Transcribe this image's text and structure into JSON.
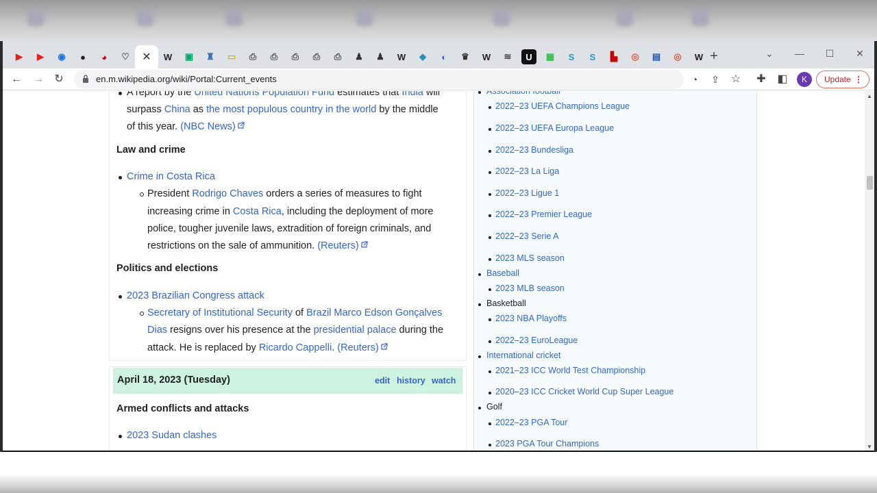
{
  "browser": {
    "url": "en.m.wikipedia.org/wiki/Portal:Current_events",
    "update_label": "Update",
    "avatar_letter": "K",
    "tabs": [
      {
        "icon": "youtube-icon",
        "glyph": "▶",
        "color": "#e62117"
      },
      {
        "icon": "youtube-icon",
        "glyph": "▶",
        "color": "#e62117"
      },
      {
        "icon": "globe-icon",
        "glyph": "◉",
        "color": "#1a73e8"
      },
      {
        "icon": "circle-logo-icon",
        "glyph": "●",
        "color": "#222"
      },
      {
        "icon": "ball-icon",
        "glyph": "◕",
        "color": "#c00"
      },
      {
        "icon": "shield-icon",
        "glyph": "♡",
        "color": "#555"
      },
      {
        "icon": "close-icon",
        "glyph": "✕",
        "color": "#333"
      },
      {
        "icon": "wikipedia-icon",
        "glyph": "W",
        "color": "#222"
      },
      {
        "icon": "square-logo-icon",
        "glyph": "▣",
        "color": "#0a6"
      },
      {
        "icon": "crest-icon",
        "glyph": "♜",
        "color": "#3a6fb0"
      },
      {
        "icon": "frame-icon",
        "glyph": "▭",
        "color": "#e0b000"
      },
      {
        "icon": "printer-icon",
        "glyph": "⎙",
        "color": "#555"
      },
      {
        "icon": "printer-icon",
        "glyph": "⎙",
        "color": "#555"
      },
      {
        "icon": "printer-icon",
        "glyph": "⎙",
        "color": "#555"
      },
      {
        "icon": "printer-icon",
        "glyph": "⎙",
        "color": "#555"
      },
      {
        "icon": "printer-icon",
        "glyph": "⎙",
        "color": "#555"
      },
      {
        "icon": "figure-icon",
        "glyph": "♟",
        "color": "#333"
      },
      {
        "icon": "figure-icon",
        "glyph": "♟",
        "color": "#333"
      },
      {
        "icon": "wikipedia-icon",
        "glyph": "W",
        "color": "#222"
      },
      {
        "icon": "drop-icon",
        "glyph": "◆",
        "color": "#2a8fbd"
      },
      {
        "icon": "globe-icon",
        "glyph": "◐",
        "color": "#2b5fd9"
      },
      {
        "icon": "crown-icon",
        "glyph": "♛",
        "color": "#333"
      },
      {
        "icon": "wikipedia-icon",
        "glyph": "W",
        "color": "#222"
      },
      {
        "icon": "strikes-icon",
        "glyph": "≋",
        "color": "#444"
      },
      {
        "icon": "u-logo-icon",
        "glyph": "U",
        "color": "#fff"
      },
      {
        "icon": "grid-icon",
        "glyph": "▦",
        "color": "#3cba54"
      },
      {
        "icon": "s-logo-icon",
        "glyph": "S",
        "color": "#1a9ad6"
      },
      {
        "icon": "s-logo-icon",
        "glyph": "S",
        "color": "#1a9ad6"
      },
      {
        "icon": "flag-icon",
        "glyph": "▙",
        "color": "#c00"
      },
      {
        "icon": "duck-icon",
        "glyph": "◎",
        "color": "#de5833"
      },
      {
        "icon": "screen-icon",
        "glyph": "▤",
        "color": "#2c5aa0"
      },
      {
        "icon": "duck-icon",
        "glyph": "◎",
        "color": "#de5833"
      },
      {
        "icon": "wikipedia-icon",
        "glyph": "W",
        "color": "#222"
      }
    ]
  },
  "main": {
    "line1": {
      "t1": "A report by the ",
      "l1": "United Nations Population Fund",
      "t2": " estimates that ",
      "l2": "India",
      "t3": " will"
    },
    "line2": {
      "t1": "surpass ",
      "l1": "China",
      "t2": " as ",
      "l2": "the most populous country in the world",
      "t3": " by the middle"
    },
    "line3": {
      "t1": "of this year. ",
      "l1": "(NBC News)"
    },
    "law_heading": "Law and crime",
    "law_topic": "Crime in Costa Rica",
    "law_l1": {
      "t1": "President ",
      "l1": "Rodrigo Chaves",
      "t2": " orders a series of measures to fight"
    },
    "law_l2": {
      "t1": "increasing crime in ",
      "l1": "Costa Rica",
      "t2": ", including the deployment of more"
    },
    "law_l3": "police, tougher juvenile laws, extradition of foreign criminals, and",
    "law_l4": {
      "t1": "restrictions on the sale of ammunition. ",
      "l1": "(Reuters)"
    },
    "politics_heading": "Politics and elections",
    "politics_topic": "2023 Brazilian Congress attack",
    "pol_l1": {
      "l1": "Secretary of Institutional Security",
      "t1": " of ",
      "l2": "Brazil Marco Edson Gonçalves"
    },
    "pol_l2": {
      "l1": "Dias",
      "t1": " resigns over his presence at the ",
      "l2": "presidential palace",
      "t2": " during the"
    },
    "pol_l3": {
      "t1": "attack. He is replaced by ",
      "l1": "Ricardo Cappelli",
      "t2": ". ",
      "l2": "(Reuters)"
    },
    "date_header": {
      "date": "April 18, 2023 (Tuesday)",
      "edit": "edit",
      "history": "history",
      "watch": "watch"
    },
    "armed_heading": "Armed conflicts and attacks",
    "armed_topic": "2023 Sudan clashes"
  },
  "sidebar": {
    "football": "Association football",
    "football_items": [
      "2022–23 UEFA Champions League",
      "2022–23 UEFA Europa League",
      "2022–23 Bundesliga",
      "2022–23 La Liga",
      "2022–23 Ligue 1",
      "2022–23 Premier League",
      "2022–23 Serie A",
      "2023 MLS season"
    ],
    "baseball": "Baseball",
    "baseball_items": [
      "2023 MLB season"
    ],
    "basketball": "Basketball",
    "basketball_items": [
      "2023 NBA Playoffs",
      "2022–23 EuroLeague"
    ],
    "cricket": "International cricket",
    "cricket_items": [
      "2021–23 ICC World Test Championship",
      "2020–23 ICC Cricket World Cup Super League"
    ],
    "golf": "Golf",
    "golf_items": [
      "2022–23 PGA Tour",
      "2023 PGA Tour Champions"
    ]
  }
}
